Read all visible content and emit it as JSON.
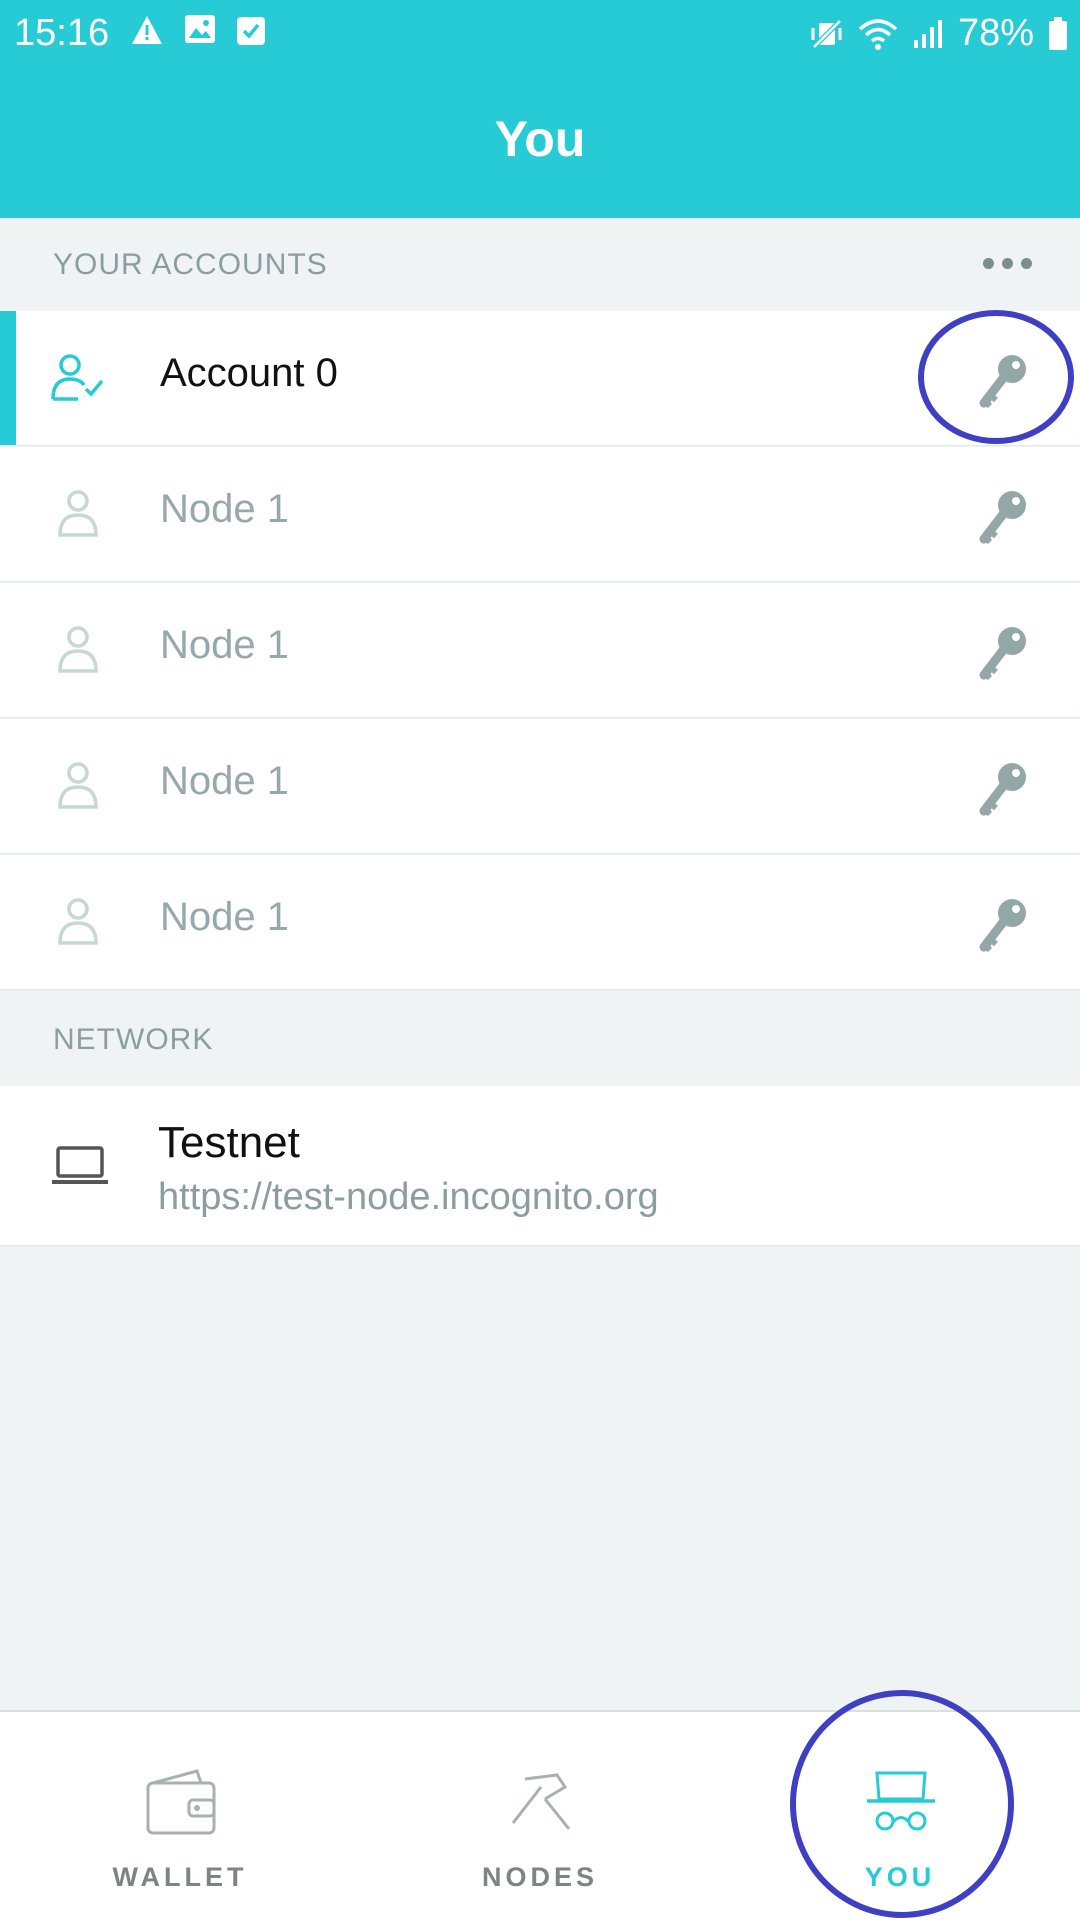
{
  "status_bar": {
    "time": "15:16",
    "battery": "78%",
    "left_icons": [
      "warning-icon",
      "image-icon",
      "check-square-icon"
    ],
    "right_icons": [
      "mute-vibrate-icon",
      "wifi-icon",
      "signal-icon",
      "battery-icon"
    ]
  },
  "header": {
    "title": "You"
  },
  "accounts": {
    "section_label": "YOUR ACCOUNTS",
    "more_label": "more-options-icon",
    "items": [
      {
        "label": "Account 0",
        "active": true
      },
      {
        "label": "Node 1",
        "active": false
      },
      {
        "label": "Node 1",
        "active": false
      },
      {
        "label": "Node 1",
        "active": false
      },
      {
        "label": "Node 1",
        "active": false
      }
    ]
  },
  "network": {
    "section_label": "NETWORK",
    "name": "Testnet",
    "url": "https://test-node.incognito.org"
  },
  "tabs": [
    {
      "label": "WALLET",
      "icon": "wallet-icon",
      "active": false
    },
    {
      "label": "NODES",
      "icon": "pickaxe-icon",
      "active": false
    },
    {
      "label": "YOU",
      "icon": "incognito-icon",
      "active": true
    }
  ],
  "colors": {
    "accent": "#27cbd6",
    "annotation": "#3f3fc4",
    "muted_text": "#96a8a9"
  }
}
